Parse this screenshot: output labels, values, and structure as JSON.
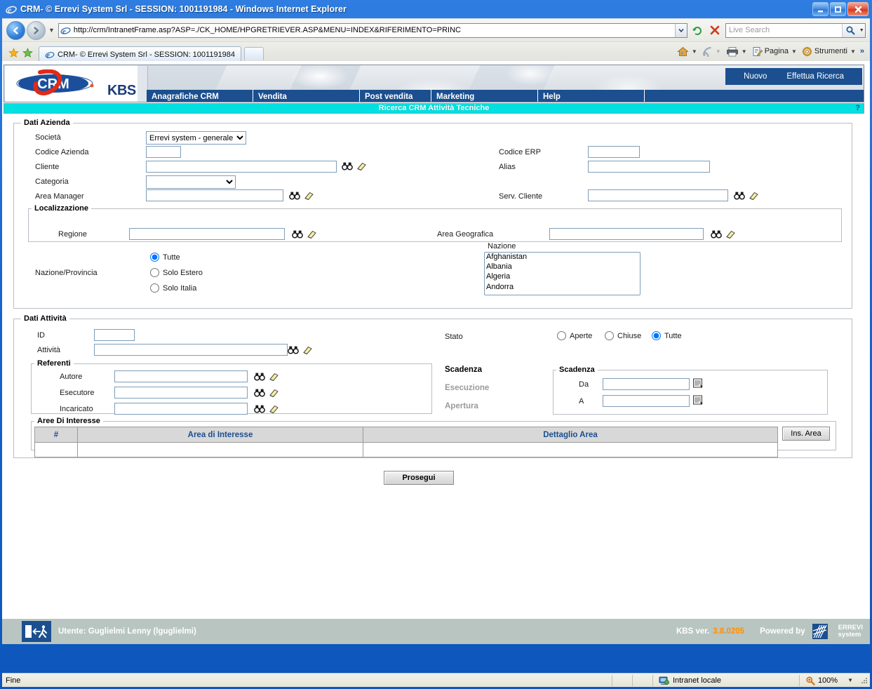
{
  "browser": {
    "window_title": "CRM- © Errevi System Srl - SESSION: 1001191984 - Windows Internet Explorer",
    "url": "http://crm/IntranetFrame.asp?ASP=./CK_HOME/HPGRETRIEVER.ASP&MENU=INDEX&RIFERIMENTO=PRINC",
    "tab_label": "CRM- © Errevi System Srl - SESSION: 1001191984",
    "search_placeholder": "Live Search",
    "search_value": "",
    "commands": [
      {
        "icon": "home-icon",
        "label": ""
      },
      {
        "icon": "feeds-icon",
        "label": ""
      },
      {
        "icon": "print-icon",
        "label": ""
      },
      {
        "icon": "page-icon",
        "label": "Pagina"
      },
      {
        "icon": "tools-icon",
        "label": "Strumenti"
      }
    ],
    "window_buttons": [
      "minimize-icon",
      "maximize-icon",
      "close-icon"
    ]
  },
  "statusbar": {
    "status": "Fine",
    "zone": "Intranet locale",
    "zoom": "100%"
  },
  "app": {
    "logo_text": "CRM",
    "brand": "KBS",
    "top_actions": [
      "Nuovo",
      "Effettua Ricerca"
    ],
    "menu": [
      "Anagrafiche CRM",
      "Vendita",
      "Post vendita",
      "Marketing",
      "Help"
    ],
    "page_title": "Ricerca CRM Attività Tecniche",
    "help_mark": "?"
  },
  "dati_azienda": {
    "legend": "Dati Azienda",
    "societa_label": "Società",
    "societa_value": "Errevi system - generale",
    "societa_options": [
      "Errevi system - generale"
    ],
    "codice_azienda_label": "Codice Azienda",
    "codice_azienda_value": "",
    "cliente_label": "Cliente",
    "cliente_value": "",
    "categoria_label": "Categoria",
    "categoria_value": "",
    "categoria_options": [
      ""
    ],
    "area_manager_label": "Area Manager",
    "area_manager_value": "",
    "codice_erp_label": "Codice ERP",
    "codice_erp_value": "",
    "alias_label": "Alias",
    "alias_value": "",
    "serv_cliente_label": "Serv. Cliente",
    "serv_cliente_value": ""
  },
  "localizzazione": {
    "legend": "Localizzazione",
    "regione_label": "Regione",
    "regione_value": "",
    "area_geografica_label": "Area Geografica",
    "area_geografica_value": ""
  },
  "nazione_provincia": {
    "label": "Nazione/Provincia",
    "selected": "Tutte",
    "options": [
      "Tutte",
      "Solo Estero",
      "Solo Italia"
    ],
    "nazione_label": "Nazione",
    "nazione_options": [
      "Afghanistan",
      "Albania",
      "Algeria",
      "Andorra"
    ]
  },
  "dati_attivita": {
    "legend": "Dati Attività",
    "id_label": "ID",
    "id_value": "",
    "attivita_label": "Attività",
    "attivita_value": "",
    "stato_label": "Stato",
    "stato_selected": "Tutte",
    "stato_options": [
      "Aperte",
      "Chiuse",
      "Tutte"
    ],
    "referenti": {
      "legend": "Referenti",
      "rows": [
        {
          "label": "Autore",
          "value": ""
        },
        {
          "label": "Esecutore",
          "value": ""
        },
        {
          "label": "Incaricato",
          "value": ""
        }
      ]
    },
    "date_mode": {
      "active": "Scadenza",
      "options": [
        "Scadenza",
        "Esecuzione",
        "Apertura"
      ]
    },
    "scadenza": {
      "legend": "Scadenza",
      "da_label": "Da",
      "da_value": "",
      "a_label": "A",
      "a_value": ""
    }
  },
  "aree_interesse": {
    "legend": "Aree Di Interesse",
    "columns": [
      "#",
      "Area di Interesse",
      "Dettaglio Area"
    ],
    "rows": [
      [
        "",
        "",
        ""
      ]
    ],
    "ins_area_button": "Ins. Area"
  },
  "actions": {
    "prosegui": "Prosegui"
  },
  "footer": {
    "user": "Utente: Guglielmi Lenny (lguglielmi)",
    "version_label": "KBS ver.",
    "version": "3.8.0205",
    "powered_by": "Powered by",
    "vendor_line1": "ERREVI",
    "vendor_line2": "system"
  }
}
